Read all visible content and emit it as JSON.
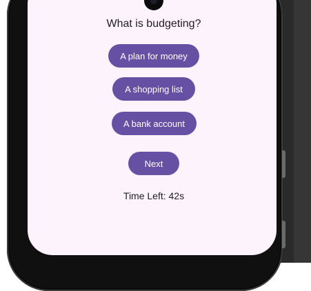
{
  "status_bar": {
    "left_text": "• • •  ▢",
    "right_text": "▾ ◢ ▮"
  },
  "quiz": {
    "question": "What is budgeting?",
    "options": [
      "A plan for money",
      "A shopping list",
      "A bank account"
    ],
    "next_label": "Next",
    "timer_text": "Time Left: 42s"
  },
  "colors": {
    "accent": "#6650a4",
    "screen_background": "#fcf3fd"
  },
  "icons": {
    "camera": "front-camera-icon"
  }
}
